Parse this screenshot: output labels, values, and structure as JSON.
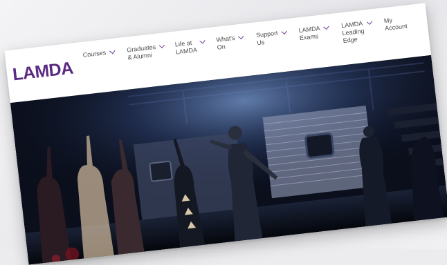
{
  "brand": {
    "logo_text": "LAMDA",
    "accent": "#5a2a82",
    "chevron_color": "#6b3a9a"
  },
  "nav": {
    "items": [
      {
        "label": "Courses",
        "has_dropdown": true
      },
      {
        "label": "Graduates\n& Alumni",
        "has_dropdown": true
      },
      {
        "label": "Life at\nLAMDA",
        "has_dropdown": true
      },
      {
        "label": "What's\nOn",
        "has_dropdown": true
      },
      {
        "label": "Support\nUs",
        "has_dropdown": true
      },
      {
        "label": "LAMDA\nExams",
        "has_dropdown": true
      },
      {
        "label": "LAMDA\nLeading\nEdge",
        "has_dropdown": true
      },
      {
        "label": "My\nAccount",
        "has_dropdown": false
      }
    ]
  },
  "hero": {
    "image": "stage-performance-photo",
    "colors": {
      "background": "#0b0f1c",
      "spotlight": "#4a6a9a",
      "stage_light": "#3a4e7a"
    }
  }
}
